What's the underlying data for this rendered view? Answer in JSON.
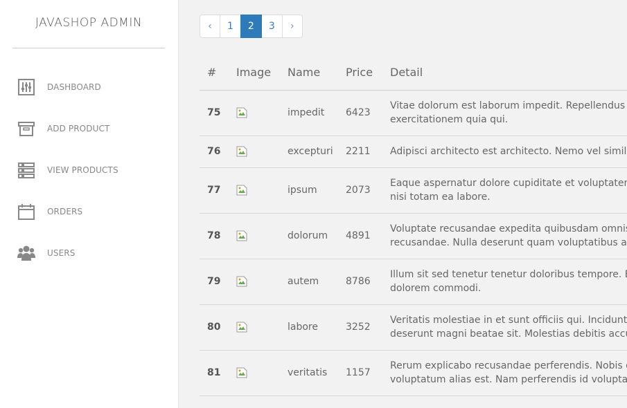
{
  "brand": "JAVASHOP ADMIN",
  "nav": [
    {
      "label": "DASHBOARD",
      "icon": "sliders-icon"
    },
    {
      "label": "ADD PRODUCT",
      "icon": "archive-box-icon"
    },
    {
      "label": "VIEW PRODUCTS",
      "icon": "list-icon"
    },
    {
      "label": "ORDERS",
      "icon": "calendar-icon"
    },
    {
      "label": "USERS",
      "icon": "users-icon"
    }
  ],
  "pagination": {
    "prev": "‹",
    "pages": [
      "1",
      "2",
      "3"
    ],
    "active": "2",
    "next": "›"
  },
  "table": {
    "headers": {
      "id": "#",
      "image": "Image",
      "name": "Name",
      "price": "Price",
      "detail": "Detail"
    },
    "rows": [
      {
        "id": "75",
        "name": "impedit",
        "price": "6423",
        "detail": [
          "Vitae dolorum est laborum impedit. Repellendus repre",
          "exercitationem quia qui."
        ]
      },
      {
        "id": "76",
        "name": "excepturi",
        "price": "2211",
        "detail": [
          "Adipisci architecto est architecto. Nemo vel similique q"
        ]
      },
      {
        "id": "77",
        "name": "ipsum",
        "price": "2073",
        "detail": [
          "Eaque aspernatur dolore cupiditate et voluptatem. Co",
          "nisi totam ea labore."
        ]
      },
      {
        "id": "78",
        "name": "dolorum",
        "price": "4891",
        "detail": [
          "Voluptate recusandae expedita quibusdam omnis bea",
          "recusandae. Nulla deserunt quam voluptatibus aliqui"
        ]
      },
      {
        "id": "79",
        "name": "autem",
        "price": "8786",
        "detail": [
          "Illum sit sed tenetur tenetur doloribus tempore. Et et d",
          "dolorem commodi."
        ]
      },
      {
        "id": "80",
        "name": "labore",
        "price": "3252",
        "detail": [
          "Veritatis molestiae in et sunt officiis qui. Incidunt labo",
          "deserunt magni beatae sit. Molestias debitis accusan"
        ]
      },
      {
        "id": "81",
        "name": "veritatis",
        "price": "1157",
        "detail": [
          "Rerum explicabo recusandae perferendis. Nobis quas",
          "voluptatum alias est. Nam perferendis id voluptates."
        ]
      }
    ]
  }
}
